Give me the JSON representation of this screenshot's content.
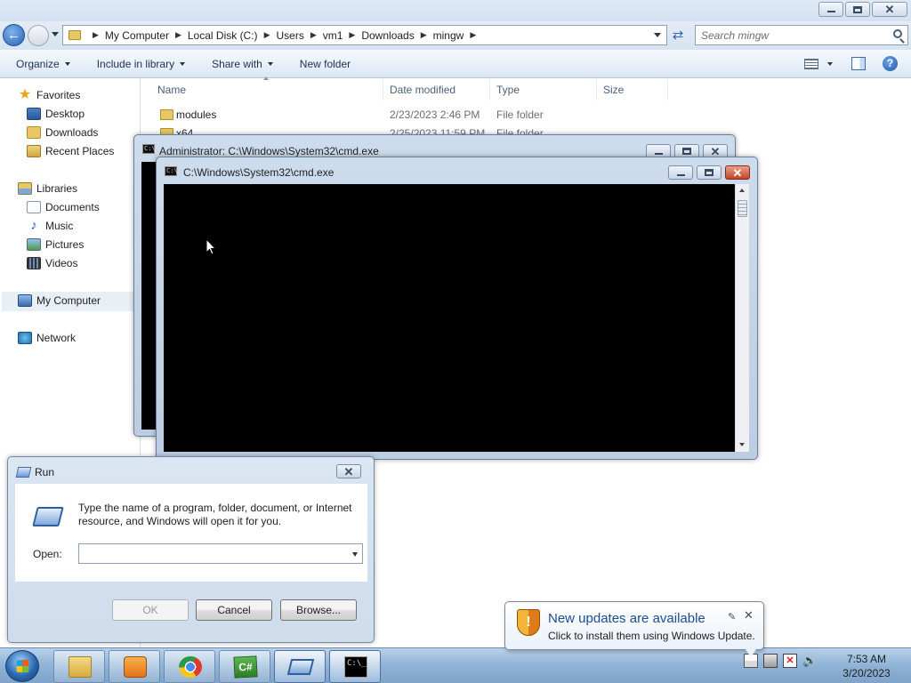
{
  "explorer": {
    "address": [
      "My Computer",
      "Local Disk (C:)",
      "Users",
      "vm1",
      "Downloads",
      "mingw"
    ],
    "search_placeholder": "Search mingw",
    "toolbar": {
      "organize": "Organize",
      "include": "Include in library",
      "share": "Share with",
      "new_folder": "New folder"
    },
    "nav": {
      "favorites": "Favorites",
      "desktop": "Desktop",
      "downloads": "Downloads",
      "recent": "Recent Places",
      "libraries": "Libraries",
      "documents": "Documents",
      "music": "Music",
      "pictures": "Pictures",
      "videos": "Videos",
      "computer": "My Computer",
      "network": "Network"
    },
    "columns": {
      "name": "Name",
      "date": "Date modified",
      "type": "Type",
      "size": "Size"
    },
    "files": [
      {
        "name": "modules",
        "date": "2/23/2023 2:46 PM",
        "type": "File folder"
      },
      {
        "name": "x64",
        "date": "2/25/2023 11:59 PM",
        "type": "File folder"
      }
    ]
  },
  "cmd_admin": {
    "title": "Administrator: C:\\Windows\\System32\\cmd.exe"
  },
  "cmd_main": {
    "title": "C:\\Windows\\System32\\cmd.exe"
  },
  "run": {
    "title": "Run",
    "message": "Type the name of a program, folder, document, or Internet resource, and Windows will open it for you.",
    "open_label": "Open:",
    "open_value": "",
    "ok": "OK",
    "cancel": "Cancel",
    "browse": "Browse..."
  },
  "notification": {
    "title": "New updates are available",
    "text": "Click to install them using Windows Update."
  },
  "taskbar": {
    "cs_label": "C#",
    "cmd_glyph": "C:\\_"
  },
  "clock": {
    "time": "7:53 AM",
    "date": "3/20/2023"
  }
}
